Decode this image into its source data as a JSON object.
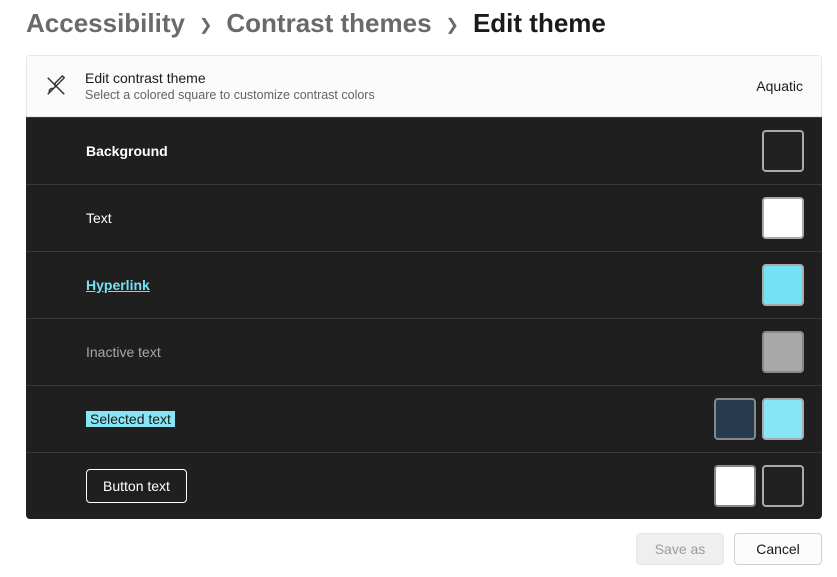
{
  "breadcrumb": {
    "items": [
      "Accessibility",
      "Contrast themes",
      "Edit theme"
    ]
  },
  "header": {
    "title": "Edit contrast theme",
    "subtitle": "Select a colored square to customize contrast colors",
    "theme_name": "Aquatic"
  },
  "rows": [
    {
      "label": "Background",
      "style": "lbl-background",
      "swatches": [
        {
          "fill": "#202020",
          "border": "#aaaaaa"
        }
      ]
    },
    {
      "label": "Text",
      "style": "lbl-text",
      "swatches": [
        {
          "fill": "#ffffff",
          "border": "#aaaaaa"
        }
      ]
    },
    {
      "label": "Hyperlink",
      "style": "lbl-hyperlink",
      "swatches": [
        {
          "fill": "#74e2f5",
          "border": "#aaaaaa"
        }
      ]
    },
    {
      "label": "Inactive text",
      "style": "lbl-inactive",
      "swatches": [
        {
          "fill": "#a8a8a8",
          "border": "#888888"
        }
      ]
    },
    {
      "label": "Selected text",
      "style": "lbl-selected",
      "swatches": [
        {
          "fill": "#263b50",
          "border": "#888888"
        },
        {
          "fill": "#88e5f5",
          "border": "#aaaaaa"
        }
      ]
    },
    {
      "label": "Button text",
      "style": "lbl-button",
      "swatches": [
        {
          "fill": "#ffffff",
          "border": "#888888"
        },
        {
          "fill": "#202020",
          "border": "#aaaaaa"
        }
      ]
    }
  ],
  "footer": {
    "save_as": "Save as",
    "cancel": "Cancel"
  }
}
